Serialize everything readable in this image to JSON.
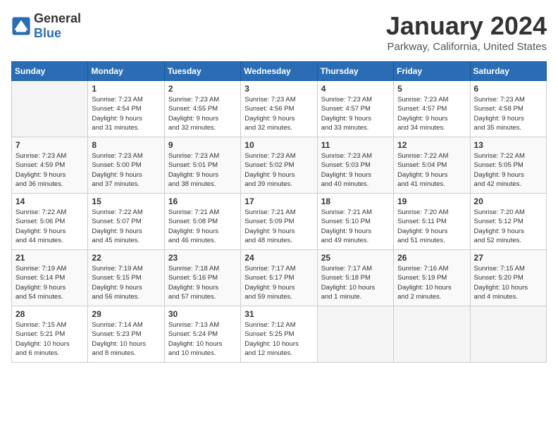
{
  "header": {
    "logo_general": "General",
    "logo_blue": "Blue",
    "month": "January 2024",
    "location": "Parkway, California, United States"
  },
  "days_of_week": [
    "Sunday",
    "Monday",
    "Tuesday",
    "Wednesday",
    "Thursday",
    "Friday",
    "Saturday"
  ],
  "weeks": [
    [
      {
        "day": "",
        "info": ""
      },
      {
        "day": "1",
        "info": "Sunrise: 7:23 AM\nSunset: 4:54 PM\nDaylight: 9 hours\nand 31 minutes."
      },
      {
        "day": "2",
        "info": "Sunrise: 7:23 AM\nSunset: 4:55 PM\nDaylight: 9 hours\nand 32 minutes."
      },
      {
        "day": "3",
        "info": "Sunrise: 7:23 AM\nSunset: 4:56 PM\nDaylight: 9 hours\nand 32 minutes."
      },
      {
        "day": "4",
        "info": "Sunrise: 7:23 AM\nSunset: 4:57 PM\nDaylight: 9 hours\nand 33 minutes."
      },
      {
        "day": "5",
        "info": "Sunrise: 7:23 AM\nSunset: 4:57 PM\nDaylight: 9 hours\nand 34 minutes."
      },
      {
        "day": "6",
        "info": "Sunrise: 7:23 AM\nSunset: 4:58 PM\nDaylight: 9 hours\nand 35 minutes."
      }
    ],
    [
      {
        "day": "7",
        "info": "Sunrise: 7:23 AM\nSunset: 4:59 PM\nDaylight: 9 hours\nand 36 minutes."
      },
      {
        "day": "8",
        "info": "Sunrise: 7:23 AM\nSunset: 5:00 PM\nDaylight: 9 hours\nand 37 minutes."
      },
      {
        "day": "9",
        "info": "Sunrise: 7:23 AM\nSunset: 5:01 PM\nDaylight: 9 hours\nand 38 minutes."
      },
      {
        "day": "10",
        "info": "Sunrise: 7:23 AM\nSunset: 5:02 PM\nDaylight: 9 hours\nand 39 minutes."
      },
      {
        "day": "11",
        "info": "Sunrise: 7:23 AM\nSunset: 5:03 PM\nDaylight: 9 hours\nand 40 minutes."
      },
      {
        "day": "12",
        "info": "Sunrise: 7:22 AM\nSunset: 5:04 PM\nDaylight: 9 hours\nand 41 minutes."
      },
      {
        "day": "13",
        "info": "Sunrise: 7:22 AM\nSunset: 5:05 PM\nDaylight: 9 hours\nand 42 minutes."
      }
    ],
    [
      {
        "day": "14",
        "info": "Sunrise: 7:22 AM\nSunset: 5:06 PM\nDaylight: 9 hours\nand 44 minutes."
      },
      {
        "day": "15",
        "info": "Sunrise: 7:22 AM\nSunset: 5:07 PM\nDaylight: 9 hours\nand 45 minutes."
      },
      {
        "day": "16",
        "info": "Sunrise: 7:21 AM\nSunset: 5:08 PM\nDaylight: 9 hours\nand 46 minutes."
      },
      {
        "day": "17",
        "info": "Sunrise: 7:21 AM\nSunset: 5:09 PM\nDaylight: 9 hours\nand 48 minutes."
      },
      {
        "day": "18",
        "info": "Sunrise: 7:21 AM\nSunset: 5:10 PM\nDaylight: 9 hours\nand 49 minutes."
      },
      {
        "day": "19",
        "info": "Sunrise: 7:20 AM\nSunset: 5:11 PM\nDaylight: 9 hours\nand 51 minutes."
      },
      {
        "day": "20",
        "info": "Sunrise: 7:20 AM\nSunset: 5:12 PM\nDaylight: 9 hours\nand 52 minutes."
      }
    ],
    [
      {
        "day": "21",
        "info": "Sunrise: 7:19 AM\nSunset: 5:14 PM\nDaylight: 9 hours\nand 54 minutes."
      },
      {
        "day": "22",
        "info": "Sunrise: 7:19 AM\nSunset: 5:15 PM\nDaylight: 9 hours\nand 56 minutes."
      },
      {
        "day": "23",
        "info": "Sunrise: 7:18 AM\nSunset: 5:16 PM\nDaylight: 9 hours\nand 57 minutes."
      },
      {
        "day": "24",
        "info": "Sunrise: 7:17 AM\nSunset: 5:17 PM\nDaylight: 9 hours\nand 59 minutes."
      },
      {
        "day": "25",
        "info": "Sunrise: 7:17 AM\nSunset: 5:18 PM\nDaylight: 10 hours\nand 1 minute."
      },
      {
        "day": "26",
        "info": "Sunrise: 7:16 AM\nSunset: 5:19 PM\nDaylight: 10 hours\nand 2 minutes."
      },
      {
        "day": "27",
        "info": "Sunrise: 7:15 AM\nSunset: 5:20 PM\nDaylight: 10 hours\nand 4 minutes."
      }
    ],
    [
      {
        "day": "28",
        "info": "Sunrise: 7:15 AM\nSunset: 5:21 PM\nDaylight: 10 hours\nand 6 minutes."
      },
      {
        "day": "29",
        "info": "Sunrise: 7:14 AM\nSunset: 5:23 PM\nDaylight: 10 hours\nand 8 minutes."
      },
      {
        "day": "30",
        "info": "Sunrise: 7:13 AM\nSunset: 5:24 PM\nDaylight: 10 hours\nand 10 minutes."
      },
      {
        "day": "31",
        "info": "Sunrise: 7:12 AM\nSunset: 5:25 PM\nDaylight: 10 hours\nand 12 minutes."
      },
      {
        "day": "",
        "info": ""
      },
      {
        "day": "",
        "info": ""
      },
      {
        "day": "",
        "info": ""
      }
    ]
  ]
}
